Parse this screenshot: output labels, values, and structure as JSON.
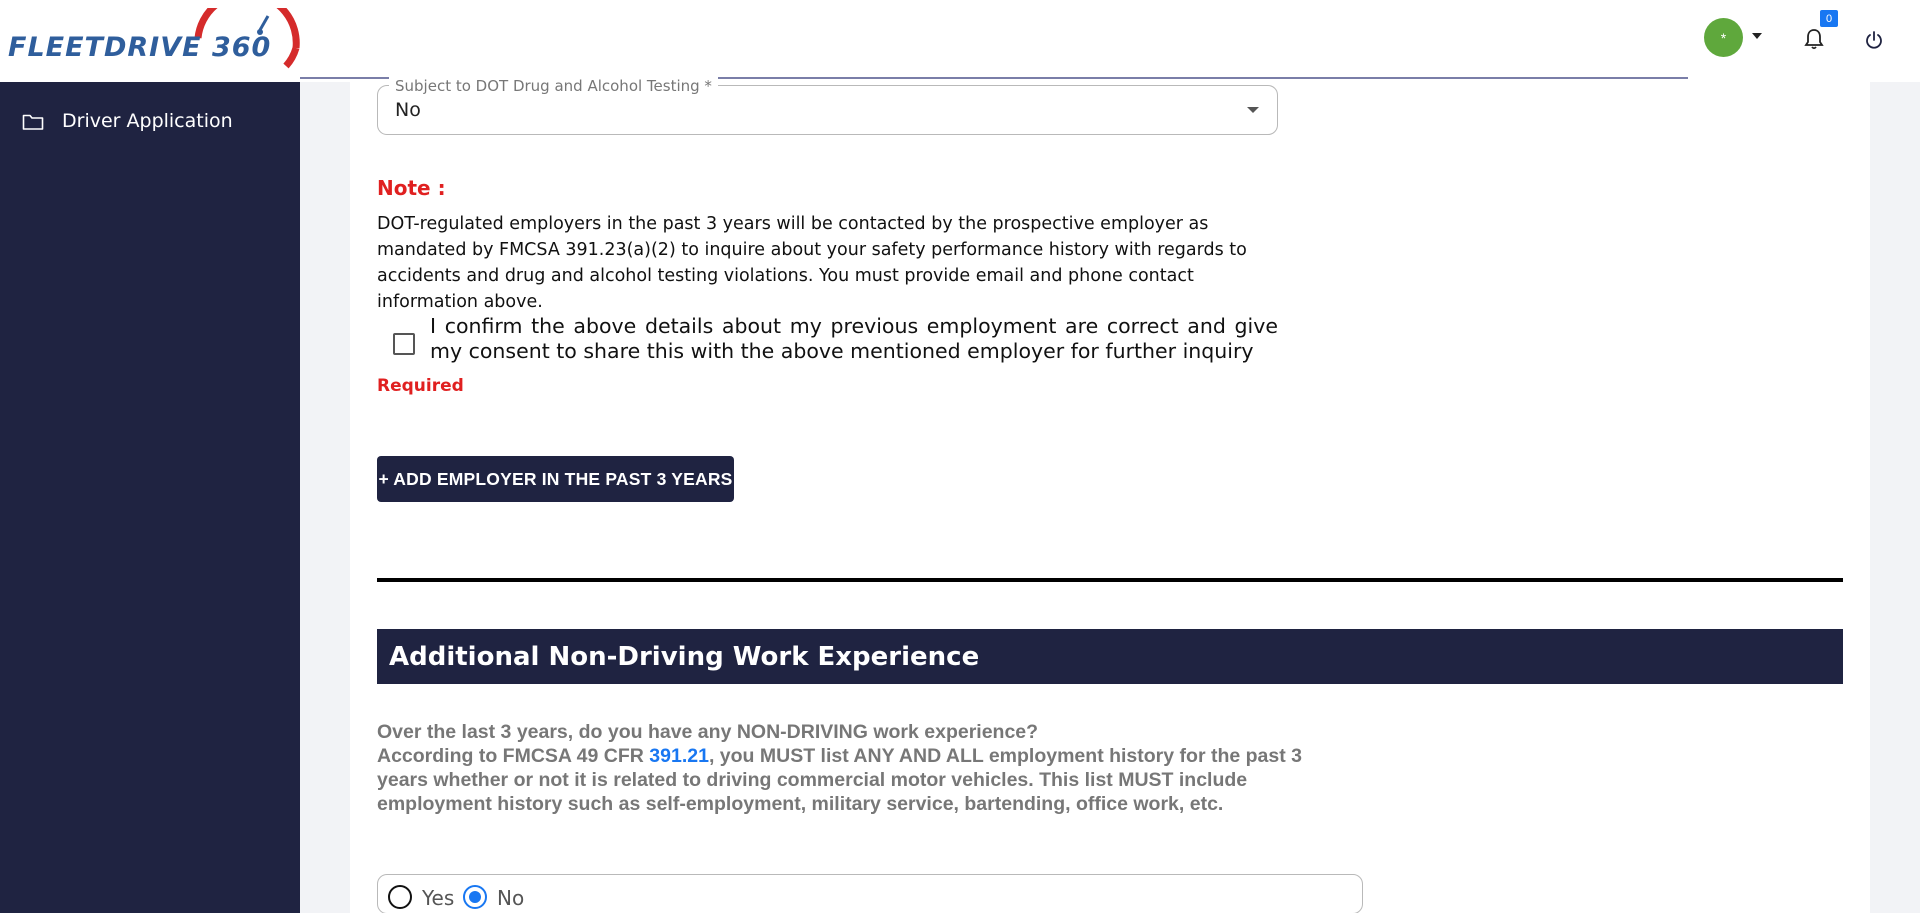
{
  "header": {
    "logo_text": "FLEETDRIVE 360",
    "avatar_initial": "*",
    "notification_count": "0",
    "colors": {
      "brand_blue": "#2f5e9c",
      "brand_red": "#d52b2b",
      "avatar_green": "#5fa83c",
      "badge_blue": "#1877f2"
    }
  },
  "sidebar": {
    "background": "#1f2341",
    "items": [
      {
        "label": "Driver Application",
        "icon": "folder-icon"
      }
    ]
  },
  "form": {
    "dot_testing": {
      "label": "Subject to DOT Drug and Alcohol Testing *",
      "value": "No"
    },
    "note_title": "Note :",
    "note_body": "DOT-regulated employers in the past 3 years will be contacted by the prospective employer as mandated by FMCSA 391.23(a)(2) to inquire about your safety performance history with regards to accidents and drug and alcohol testing violations. You must provide email and phone contact information above.",
    "consent_text": "I confirm the above details about my previous employment are correct and give my consent to share this with the above mentioned employer for further inquiry",
    "consent_checked": false,
    "required_text": "Required",
    "add_employer_button": "+ ADD EMPLOYER IN THE PAST 3 YEARS"
  },
  "non_driving": {
    "section_title": "Additional Non-Driving Work Experience",
    "question": "Over the last 3 years, do you have any NON-DRIVING work experience?",
    "info_before_link": "According to FMCSA 49 CFR ",
    "info_link": "391.21",
    "info_after_link": ", you MUST list ANY AND ALL employment history for the past 3 years whether or not it is related to driving commercial motor vehicles. This list MUST include employment history such as self-employment, military service, bartending, office work, etc.",
    "options": [
      {
        "label": "Yes",
        "selected": false
      },
      {
        "label": "No",
        "selected": true
      }
    ]
  }
}
